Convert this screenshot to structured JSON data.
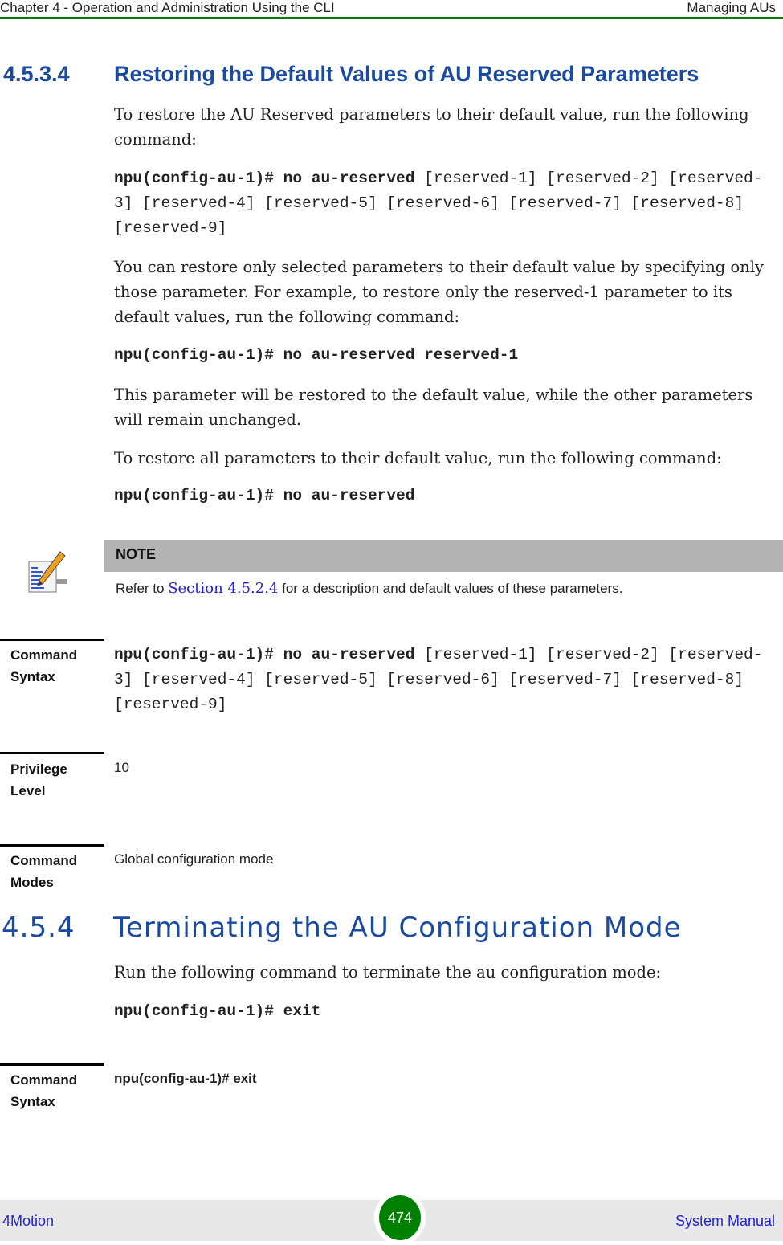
{
  "header": {
    "chapter": "Chapter 4 - Operation and Administration Using the CLI",
    "section": "Managing AUs"
  },
  "section_4534": {
    "number": "4.5.3.4",
    "title": "Restoring the Default Values of AU Reserved Parameters",
    "intro": "To restore the AU Reserved parameters to their default value, run the following command:",
    "cmd1_bold": "npu(config-au-1)# no au-reserved",
    "cmd1_rest": " [reserved-1] [reserved-2] [reserved-3] [reserved-4] [reserved-5] [reserved-6] [reserved-7] [reserved-8] [reserved-9]",
    "para2": "You can restore only selected parameters to their default value by specifying only those parameter. For example, to restore only the reserved-1 parameter to its default values, run the following command:",
    "cmd2": "npu(config-au-1)# no au-reserved reserved-1",
    "para3": "This parameter will be restored to the default value, while the other parameters will remain unchanged.",
    "para4": "To restore all parameters to their default value, run the following command:",
    "cmd3": "npu(config-au-1)# no au-reserved"
  },
  "note": {
    "icon": "note-pencil-icon",
    "title": "NOTE",
    "text_before": "Refer to ",
    "link": "Section 4.5.2.4",
    "text_after": " for a description and default values of these parameters."
  },
  "command_table": {
    "syntax_label": "Command Syntax",
    "syntax_bold": "npu(config-au-1)# no au-reserved",
    "syntax_rest": " [reserved-1] [reserved-2] [reserved-3] [reserved-4] [reserved-5] [reserved-6] [reserved-7] [reserved-8] [reserved-9]",
    "privilege_label": "Privilege Level",
    "privilege_value": "10",
    "modes_label": "Command Modes",
    "modes_value": "Global configuration mode"
  },
  "section_454": {
    "number": "4.5.4",
    "title": "Terminating the AU Configuration Mode",
    "intro": "Run the following command to terminate the au configuration mode:",
    "cmd": "npu(config-au-1)# exit",
    "syntax_label": "Command Syntax",
    "syntax_value": "npu(config-au-1)# exit"
  },
  "footer": {
    "left": "4Motion",
    "page": "474",
    "right": "System Manual"
  }
}
